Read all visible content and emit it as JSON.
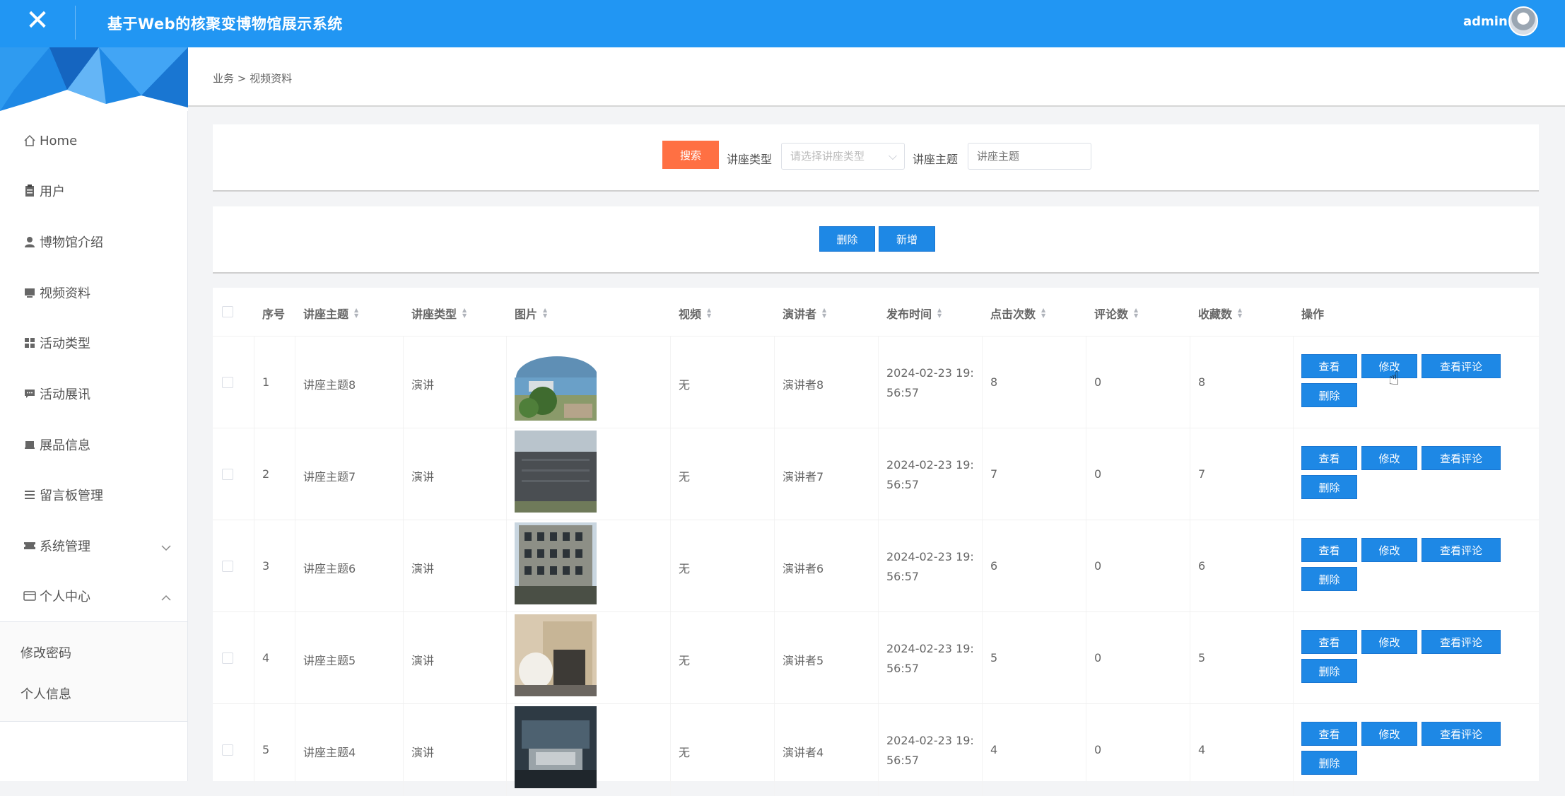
{
  "header": {
    "title": "基于Web的核聚变博物馆展示系统",
    "user": "admin"
  },
  "sidebar": {
    "items": [
      {
        "label": "Home",
        "icon": "home-icon"
      },
      {
        "label": "用户",
        "icon": "clipboard-icon"
      },
      {
        "label": "博物馆介绍",
        "icon": "person-icon"
      },
      {
        "label": "视频资料",
        "icon": "monitor-icon"
      },
      {
        "label": "活动类型",
        "icon": "grid-icon"
      },
      {
        "label": "活动展讯",
        "icon": "message-icon"
      },
      {
        "label": "展品信息",
        "icon": "store-icon"
      },
      {
        "label": "留言板管理",
        "icon": "list-icon"
      },
      {
        "label": "系统管理",
        "icon": "ticket-icon"
      },
      {
        "label": "个人中心",
        "icon": "wallet-icon"
      }
    ],
    "sub_items": [
      "修改密码",
      "个人信息"
    ]
  },
  "breadcrumb": "业务 > 视频资料",
  "search": {
    "button": "搜索",
    "type_label": "讲座类型",
    "type_placeholder": "请选择讲座类型",
    "topic_label": "讲座主题",
    "topic_placeholder": "讲座主题"
  },
  "actions": {
    "delete": "删除",
    "add": "新增"
  },
  "table": {
    "columns": [
      "序号",
      "讲座主题",
      "讲座类型",
      "图片",
      "视频",
      "演讲者",
      "发布时间",
      "点击次数",
      "评论数",
      "收藏数",
      "操作"
    ],
    "row_buttons": {
      "view": "查看",
      "edit": "修改",
      "comments": "查看评论",
      "delete": "删除"
    },
    "rows": [
      {
        "index": "1",
        "topic": "讲座主题8",
        "type": "演讲",
        "video": "无",
        "speaker": "演讲者8",
        "time": "2024-02-23 19:56:57",
        "clicks": "8",
        "comments": "0",
        "favorites": "8"
      },
      {
        "index": "2",
        "topic": "讲座主题7",
        "type": "演讲",
        "video": "无",
        "speaker": "演讲者7",
        "time": "2024-02-23 19:56:57",
        "clicks": "7",
        "comments": "0",
        "favorites": "7"
      },
      {
        "index": "3",
        "topic": "讲座主题6",
        "type": "演讲",
        "video": "无",
        "speaker": "演讲者6",
        "time": "2024-02-23 19:56:57",
        "clicks": "6",
        "comments": "0",
        "favorites": "6"
      },
      {
        "index": "4",
        "topic": "讲座主题5",
        "type": "演讲",
        "video": "无",
        "speaker": "演讲者5",
        "time": "2024-02-23 19:56:57",
        "clicks": "5",
        "comments": "0",
        "favorites": "5"
      },
      {
        "index": "5",
        "topic": "讲座主题4",
        "type": "演讲",
        "video": "无",
        "speaker": "演讲者4",
        "time": "2024-02-23 19:56:57",
        "clicks": "4",
        "comments": "0",
        "favorites": "4"
      }
    ]
  },
  "colors": {
    "header": "#2196f3",
    "primary_button": "#1e88e5",
    "search_button": "#ff7043"
  }
}
